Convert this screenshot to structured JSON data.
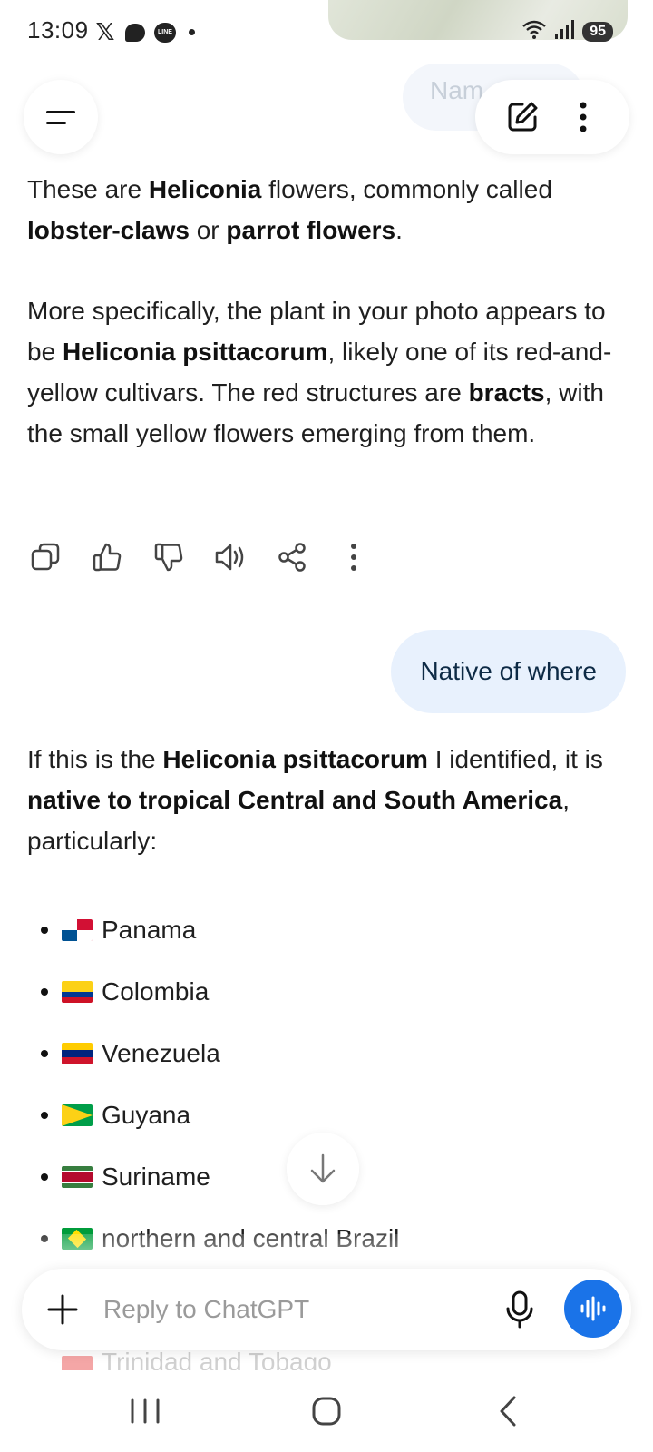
{
  "status_bar": {
    "time": "13:09",
    "battery": "95",
    "notification_icons": [
      "x-icon",
      "chat-bubble-icon",
      "line-icon",
      "dot-icon"
    ]
  },
  "header": {
    "ghost_text": "Nam",
    "menu_icon": "hamburger-icon",
    "new_chat_icon": "edit-icon",
    "more_icon": "more-vertical-icon"
  },
  "conversation": {
    "assistant_msg_1": {
      "p1": [
        {
          "text": "These are ",
          "bold": false
        },
        {
          "text": "Heliconia",
          "bold": true
        },
        {
          "text": " flowers, commonly called ",
          "bold": false
        },
        {
          "text": "lobster-claws",
          "bold": true
        },
        {
          "text": " or ",
          "bold": false
        },
        {
          "text": "parrot flowers",
          "bold": true
        },
        {
          "text": ".",
          "bold": false
        }
      ],
      "p2": [
        {
          "text": "More specifically, the plant in your photo appears to be ",
          "bold": false
        },
        {
          "text": "Heliconia psittacorum",
          "bold": true
        },
        {
          "text": ", likely one of its red-and-yellow cultivars. The red structures are ",
          "bold": false
        },
        {
          "text": "bracts",
          "bold": true
        },
        {
          "text": ", with the small yellow flowers emerging from them.",
          "bold": false
        }
      ]
    },
    "message_actions": [
      "copy-icon",
      "thumbs-up-icon",
      "thumbs-down-icon",
      "read-aloud-icon",
      "share-icon",
      "more-vertical-icon"
    ],
    "user_msg": "Native of where",
    "assistant_msg_2": {
      "intro": [
        {
          "text": "If this is the ",
          "bold": false
        },
        {
          "text": "Heliconia psittacorum",
          "bold": true
        },
        {
          "text": " I identified, it is ",
          "bold": false
        },
        {
          "text": "native to tropical Central and South America",
          "bold": true
        },
        {
          "text": ", particularly:",
          "bold": false
        }
      ],
      "regions": [
        {
          "flag": "panama",
          "label": "Panama"
        },
        {
          "flag": "colombia",
          "label": "Colombia"
        },
        {
          "flag": "venezuela",
          "label": "Venezuela"
        },
        {
          "flag": "guyana",
          "label": "Guyana"
        },
        {
          "flag": "suriname",
          "label": "Suriname"
        },
        {
          "flag": "brazil",
          "label": "northern and central Brazil"
        }
      ],
      "faded_region": "Trinidad and Tobago"
    }
  },
  "composer": {
    "placeholder": "Reply to ChatGPT",
    "value": ""
  },
  "colors": {
    "accent": "#1a73e8",
    "user_bubble": "#e8f1fd"
  }
}
